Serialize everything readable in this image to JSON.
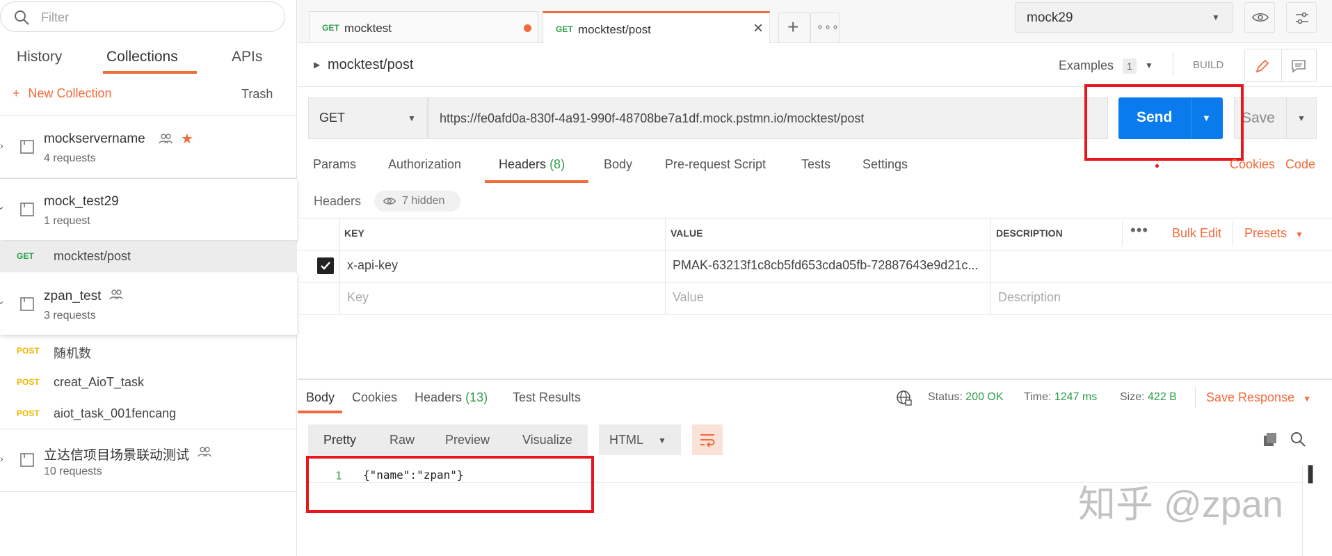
{
  "sidebar": {
    "filter_placeholder": "Filter",
    "tabs": [
      "History",
      "Collections",
      "APIs"
    ],
    "new_collection": "New Collection",
    "trash": "Trash",
    "collections": [
      {
        "name": "mockservername",
        "count": "4 requests"
      },
      {
        "name": "mock_test29",
        "count": "1 request"
      },
      {
        "name": "zpan_test",
        "count": "3 requests"
      },
      {
        "name": "立达信项目场景联动测试",
        "count": "10 requests"
      }
    ],
    "requests": [
      {
        "method": "GET",
        "name": "mocktest/post"
      },
      {
        "method": "POST",
        "name": "随机数"
      },
      {
        "method": "POST",
        "name": "creat_AioT_task"
      },
      {
        "method": "POST",
        "name": "aiot_task_001fencang"
      }
    ]
  },
  "tabs": [
    {
      "method": "GET",
      "name": "mocktest"
    },
    {
      "method": "GET",
      "name": "mocktest/post"
    }
  ],
  "environment": "mock29",
  "request": {
    "breadcrumb": "mocktest/post",
    "examples_label": "Examples",
    "examples_count": "1",
    "build_label": "BUILD",
    "method": "GET",
    "url": "https://fe0afd0a-830f-4a91-990f-48708be7a1df.mock.pstmn.io/mocktest/post",
    "send": "Send",
    "save": "Save",
    "subtabs": [
      "Params",
      "Authorization",
      "Headers",
      "Body",
      "Pre-request Script",
      "Tests",
      "Settings"
    ],
    "headers_count": "(8)",
    "cookies": "Cookies",
    "code": "Code",
    "headers_label": "Headers",
    "hidden": "7 hidden",
    "table": {
      "cols": [
        "KEY",
        "VALUE",
        "DESCRIPTION"
      ],
      "bulk_edit": "Bulk Edit",
      "presets": "Presets",
      "row": {
        "key": "x-api-key",
        "value": "PMAK-63213f1c8cb5fd653cda05fb-72887643e9d21c..."
      },
      "placeholders": {
        "key": "Key",
        "value": "Value",
        "desc": "Description"
      }
    }
  },
  "response": {
    "tabs": [
      "Body",
      "Cookies",
      "Headers",
      "Test Results"
    ],
    "headers_count": "(13)",
    "status_label": "Status:",
    "status": "200 OK",
    "time_label": "Time:",
    "time": "1247 ms",
    "size_label": "Size:",
    "size": "422 B",
    "save_response": "Save Response",
    "formats": [
      "Pretty",
      "Raw",
      "Preview",
      "Visualize"
    ],
    "lang": "HTML",
    "line_no": "1",
    "body": "{\"name\":\"zpan\"}"
  },
  "watermark": "知乎 @zpan",
  "colors": {
    "accent": "#f26b3a",
    "send": "#097bed",
    "highlight": "#e8171d",
    "status_ok": "#2e9e4a"
  }
}
